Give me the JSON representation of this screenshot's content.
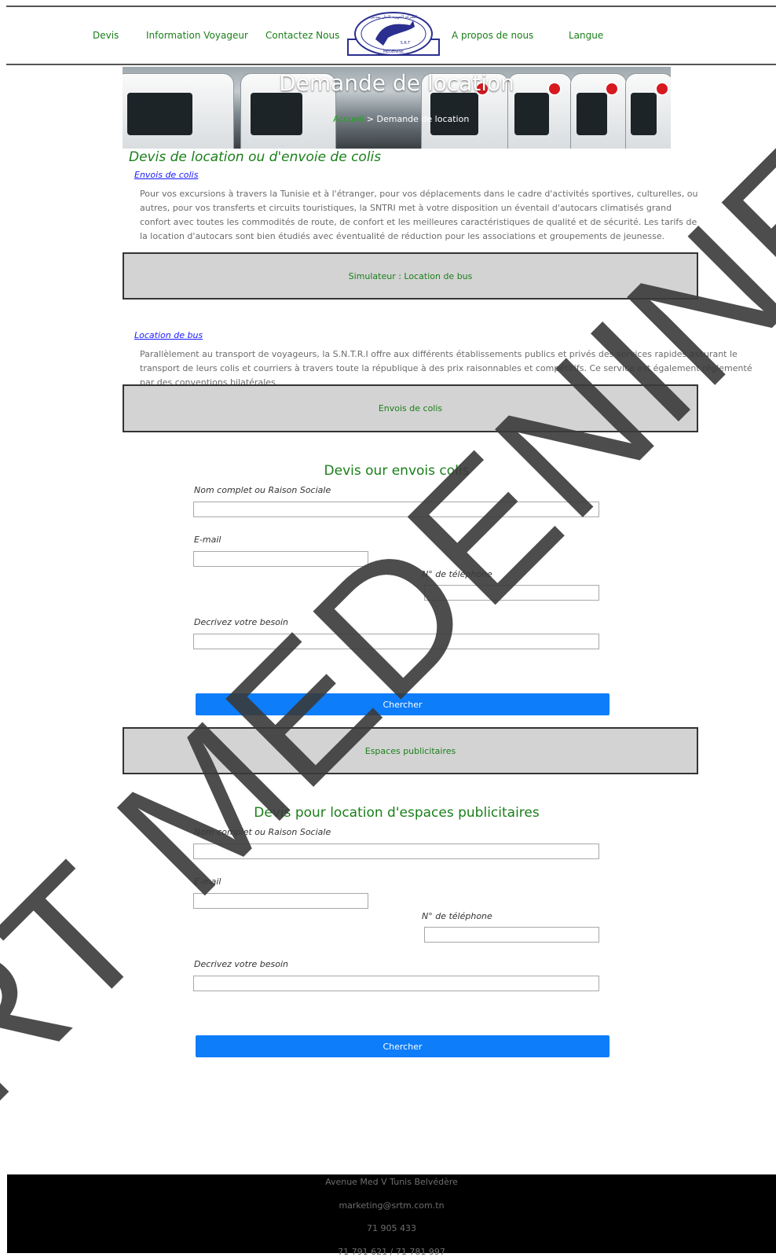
{
  "nav": {
    "devis": "Devis",
    "info": "Information Voyageur",
    "contact": "Contactez Nous",
    "about": "A propos de nous",
    "langue": "Langue"
  },
  "logo": {
    "icon": "srtm-logo",
    "arabic_text": "الشركة الجهوية للنقل بمدنين",
    "latin_text": "S.R.T",
    "city": "MEDENINE"
  },
  "hero": {
    "title": "Demande de location",
    "crumb_home": "Accueil",
    "crumb_sep": ">",
    "crumb_current": "Demande de location"
  },
  "main": {
    "title": "Devis de location ou d'envoie de colis",
    "link1": "Envois de colis",
    "para1": "Pour vos excursions à travers la Tunisie et à l'étranger, pour vos déplacements dans le cadre d'activités sportives, culturelles, ou autres, pour vos transferts et circuits touristiques, la SNTRI met à votre disposition un éventail d'autocars climatisés grand confort avec toutes les commodités de route, de confort et les meilleures caractéristiques de qualité et de sécurité. Les tarifs de la location d'autocars sont bien étudiés avec éventualité de réduction pour les associations et groupements de jeunesse.",
    "box1": "Simulateur : Location de bus",
    "link2": "Location de bus",
    "para2": "Parallèlement au transport de voyageurs, la S.N.T.R.I offre aux différents établissements publics et privés des services rapides assurant le transport de leurs colis et courriers à travers toute la république à des prix raisonnables et compétitifs. Ce service est également réglementé par des conventions bilatérales.",
    "box2": "Envois de colis",
    "box3": "Espaces publicitaires"
  },
  "form1": {
    "title": "Devis our envois colis",
    "name_label": "Nom complet ou Raison Sociale",
    "email_label": "E-mail",
    "phone_label": "N° de téléphone",
    "need_label": "Decrivez votre besoin",
    "button": "Chercher"
  },
  "form2": {
    "title": "Devis pour location d'espaces publicitaires",
    "name_label": "Nom complet ou Raison Sociale",
    "email_label": "E-mail",
    "phone_label": "N° de téléphone",
    "need_label": "Decrivez votre besoin",
    "button": "Chercher"
  },
  "footer": {
    "address": "Avenue Med V Tunis Belvédère",
    "email": "marketing@srtm.com.tn",
    "phone1": "71 905 433",
    "phone2": "71 791 621 / 71 781 997"
  },
  "watermark": {
    "text": "SRT MEDENINE",
    "color": "#3a3a3a"
  },
  "colors": {
    "green": "#1a7f1a",
    "blue_button": "#0d7dfa",
    "link_blue": "#1a1aff",
    "box_gray": "#d3d3d3"
  }
}
